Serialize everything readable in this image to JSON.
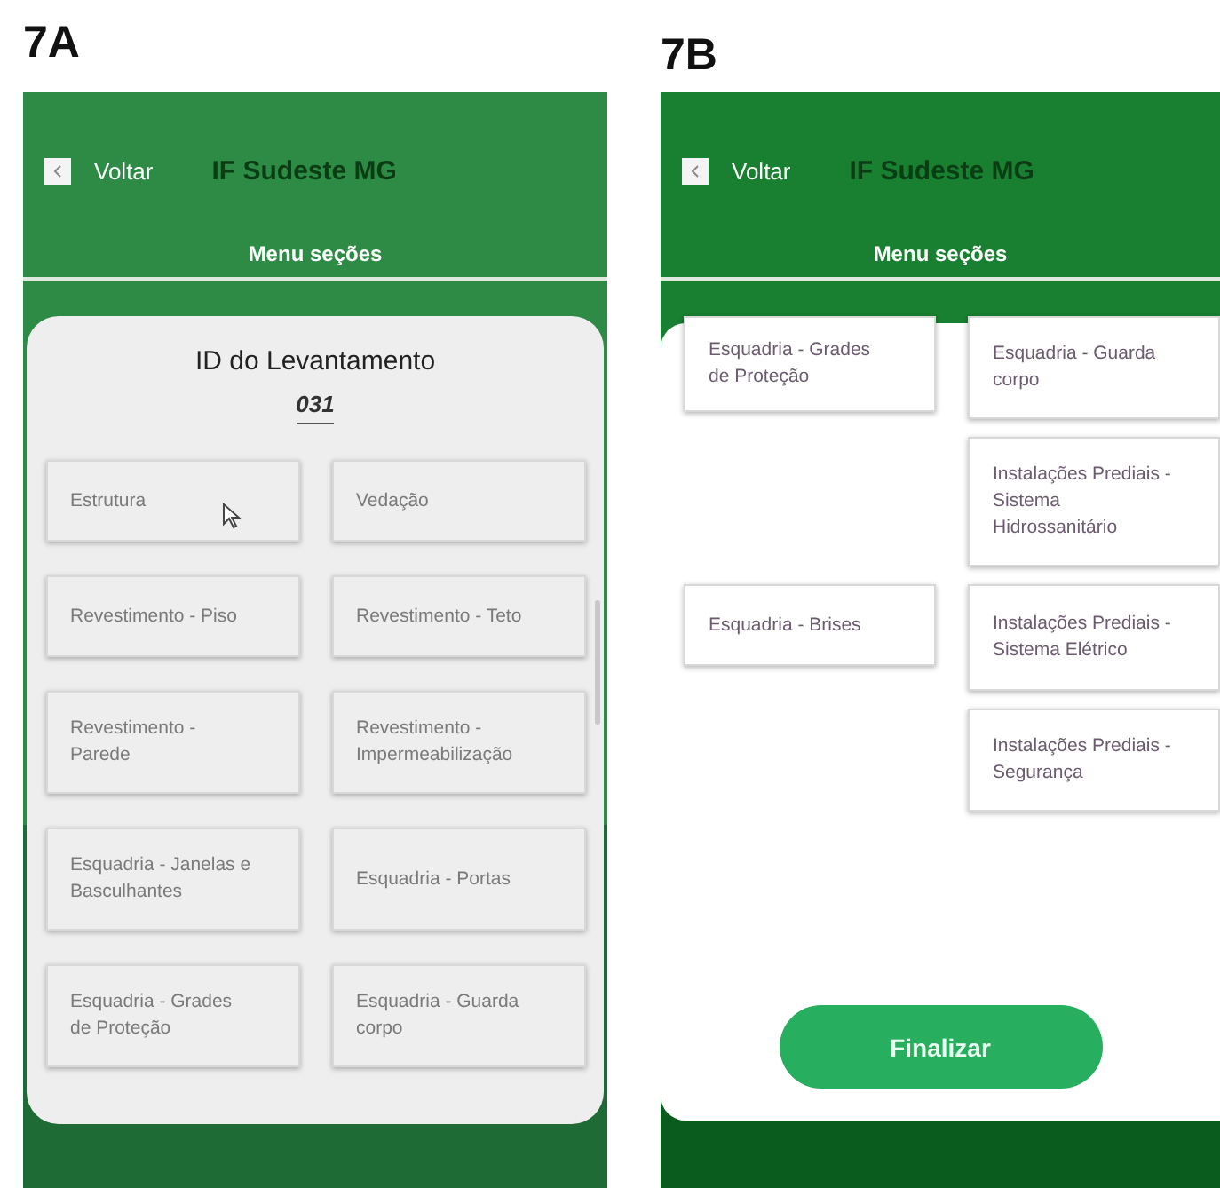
{
  "panels": [
    {
      "label": "7A",
      "kind": "survey",
      "back": "Voltar",
      "title": "IF Sudeste MG",
      "subtitle": "Menu seções",
      "survey_label": "ID do Levantamento",
      "survey_id": "031",
      "sections": [
        "Estrutura",
        "Vedação",
        "Revestimento - Piso",
        "Revestimento - Teto",
        "Revestimento - Parede",
        "Revestimento - Impermeabilização",
        "Esquadria - Janelas e Basculhantes",
        "Esquadria - Portas",
        "Esquadria - Grades de Proteção",
        "Esquadria - Guarda corpo"
      ]
    },
    {
      "label": "7B",
      "kind": "finish",
      "back": "Voltar",
      "title": "IF Sudeste MG",
      "subtitle": "Menu seções",
      "rows": [
        {
          "left": "Esquadria - Grades de Proteção",
          "right": "Esquadria - Guarda corpo"
        },
        {
          "right": "Instalações Prediais - Sistema Hidrossanitário"
        },
        {
          "left": "Esquadria - Brises",
          "right": "Instalações Prediais - Sistema Elétrico"
        },
        {
          "right": "Instalações Prediais - Segurança"
        }
      ],
      "finish_button": "Finalizar"
    }
  ]
}
